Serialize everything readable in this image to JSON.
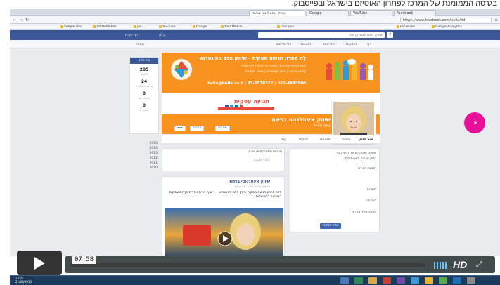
{
  "caption": {
    "text": "בגרסה הממומנת של המרכז לפתרון האוטיזם בישראל ובפייסבוק."
  },
  "browser": {
    "tabs": [
      {
        "label": "שיווק אינטלגנטי ברשת"
      },
      {
        "label": "Google"
      },
      {
        "label": "YouTube"
      },
      {
        "label": "Facebook"
      }
    ],
    "url": "https://www.facebook.com/bella/ltd"
  },
  "bookmarks": [
    "Simple site",
    "ZiftOnMobile",
    "יומן",
    "YouTube",
    "Google",
    "Yoo! Mobile",
    "Groupon",
    "Facebook",
    "Google Analytics"
  ],
  "facebook": {
    "logo": "f",
    "search_placeholder": "שיווק אינטלגנטי ברשת",
    "user_label": "בלה",
    "header_right": "דף הבית"
  },
  "page_nav": [
    "דף",
    "הודעות",
    "התראות",
    "תובנות",
    "כלי פרסום",
    "עזרה"
  ],
  "cover": {
    "headline": "לָה פתרון תנועה מסקית - שיווק חכם באינטרנט",
    "line1": "ייעוץ ובניית אתרים | רשתות חברתיות | ליווי עסקי",
    "line2": "קידום אורגני | ניהול קמפיינים | שיווק בדיגיטל",
    "phone": "052-4892900 | 03-5530312 | bella@bella.co.il",
    "brand": "תנועה עסקית"
  },
  "page": {
    "name": "שיווק אינטלגנטי ברשת",
    "category": "עסק מקומי",
    "btn_like": "אהבתי",
    "btn_message": "הודעה",
    "btn_more": "•••"
  },
  "page_tabs": [
    "ציר הזמן",
    "אודות",
    "תמונות",
    "לייקים",
    "עוד"
  ],
  "left_col": {
    "header": "ציר הזמן",
    "stats": [
      {
        "num": "205",
        "label": "לייקים"
      },
      {
        "num": "24",
        "label": "מדברים על זה"
      },
      {
        "num": "0",
        "label": "ביקרו כאן"
      },
      {
        "num": "0",
        "label": "מתוך 5"
      }
    ]
  },
  "years": [
    "2015",
    "2014",
    "2013",
    "2012",
    "2011",
    "2010"
  ],
  "composer": {
    "tabs": "סטטוס   תמונה/וידאו   אירוע",
    "placeholder": "כתוב משהו..."
  },
  "post": {
    "author": "שיווק אינטלגנטי ברשת",
    "meta": "פורסם על ידי בלה · 18 במרץ",
    "text": "בלה פתרון תנועה מסקית שיווק חכם באינטרנט — ייעוץ, בניית אתרים וקידום עסקים ברשתות החברתיות"
  },
  "right_col": {
    "lines": [
      "אנשים שאוהבים את הדף הזה",
      "הזמן חברים לעשות לייק",
      "הזמנת חברים",
      "תמונות",
      "סרטונים",
      "פוסטים של אחרים"
    ],
    "button": "שלח הזמנה"
  },
  "player": {
    "time": "07:58",
    "progress_fraction": 0.0,
    "hd_label": "HD"
  },
  "taskbar": {
    "time": "14:24",
    "date": "21/08/2015"
  },
  "colors": {
    "fb_blue": "#3b5998",
    "orange": "#f7931e",
    "cursor": "#e8119a"
  }
}
